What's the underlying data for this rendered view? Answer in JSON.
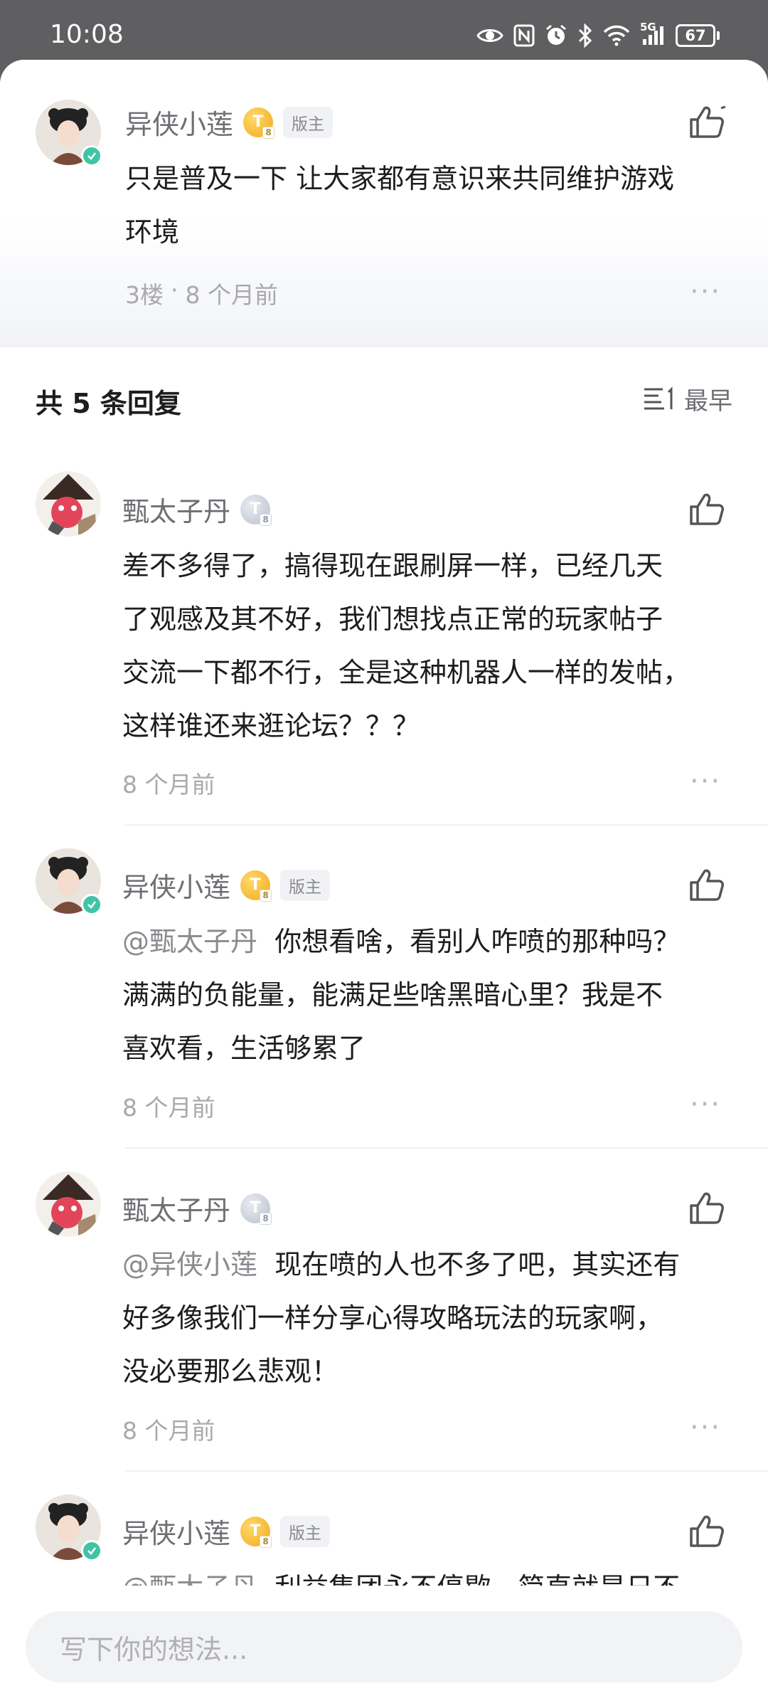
{
  "status_bar": {
    "time": "10:08",
    "network": "5G",
    "battery": "67",
    "icons": [
      "eye-icon",
      "nfc-icon",
      "alarm-icon",
      "bluetooth-icon",
      "wifi-icon",
      "signal-icon",
      "battery-icon"
    ]
  },
  "colors": {
    "accent_verify": "#3fc5a5",
    "gold_badge": "#f2a91a",
    "muted_text": "#a9a9ae"
  },
  "top_comment": {
    "username": "异侠小莲",
    "badge_letter": "T",
    "badge_sub": "8",
    "role": "版主",
    "text_line1": "只是普及一下 让大家都有意识来共同维护游戏",
    "text_line2": "环境",
    "floor": "3楼",
    "dot": "·",
    "time": "8 个月前",
    "more": "···"
  },
  "replies_header": {
    "title": "共 5 条回复",
    "sort_label": "最早"
  },
  "replies": [
    {
      "username": "甄太子丹",
      "badge_letter": "T",
      "badge_sub": "8",
      "mention": "",
      "lines": [
        "差不多得了，搞得现在跟刷屏一样，已经几天",
        "了观感及其不好，我们想找点正常的玩家帖子",
        "交流一下都不行，全是这种机器人一样的发帖，",
        "这样谁还来逛论坛？？？"
      ],
      "time": "8 个月前",
      "more": "···"
    },
    {
      "username": "异侠小莲",
      "badge_letter": "T",
      "badge_sub": "8",
      "role": "版主",
      "mention": "@甄太子丹",
      "lines": [
        "你想看啥，看别人咋喷的那种吗？",
        "满满的负能量，能满足些啥黑暗心里？我是不",
        "喜欢看，生活够累了"
      ],
      "time": "8 个月前",
      "more": "···"
    },
    {
      "username": "甄太子丹",
      "badge_letter": "T",
      "badge_sub": "8",
      "mention": "@异侠小莲",
      "lines": [
        "现在喷的人也不多了吧，其实还有",
        "好多像我们一样分享心得攻略玩法的玩家啊，",
        "没必要那么悲观！"
      ],
      "time": "8 个月前",
      "more": "···"
    },
    {
      "username": "异侠小莲",
      "badge_letter": "T",
      "badge_sub": "8",
      "role": "版主",
      "mention": "@甄太子丹",
      "lines": [
        "利益集团永不停歇，简直就是日不"
      ],
      "time": "",
      "more": ""
    }
  ],
  "composer": {
    "placeholder": "写下你的想法..."
  }
}
